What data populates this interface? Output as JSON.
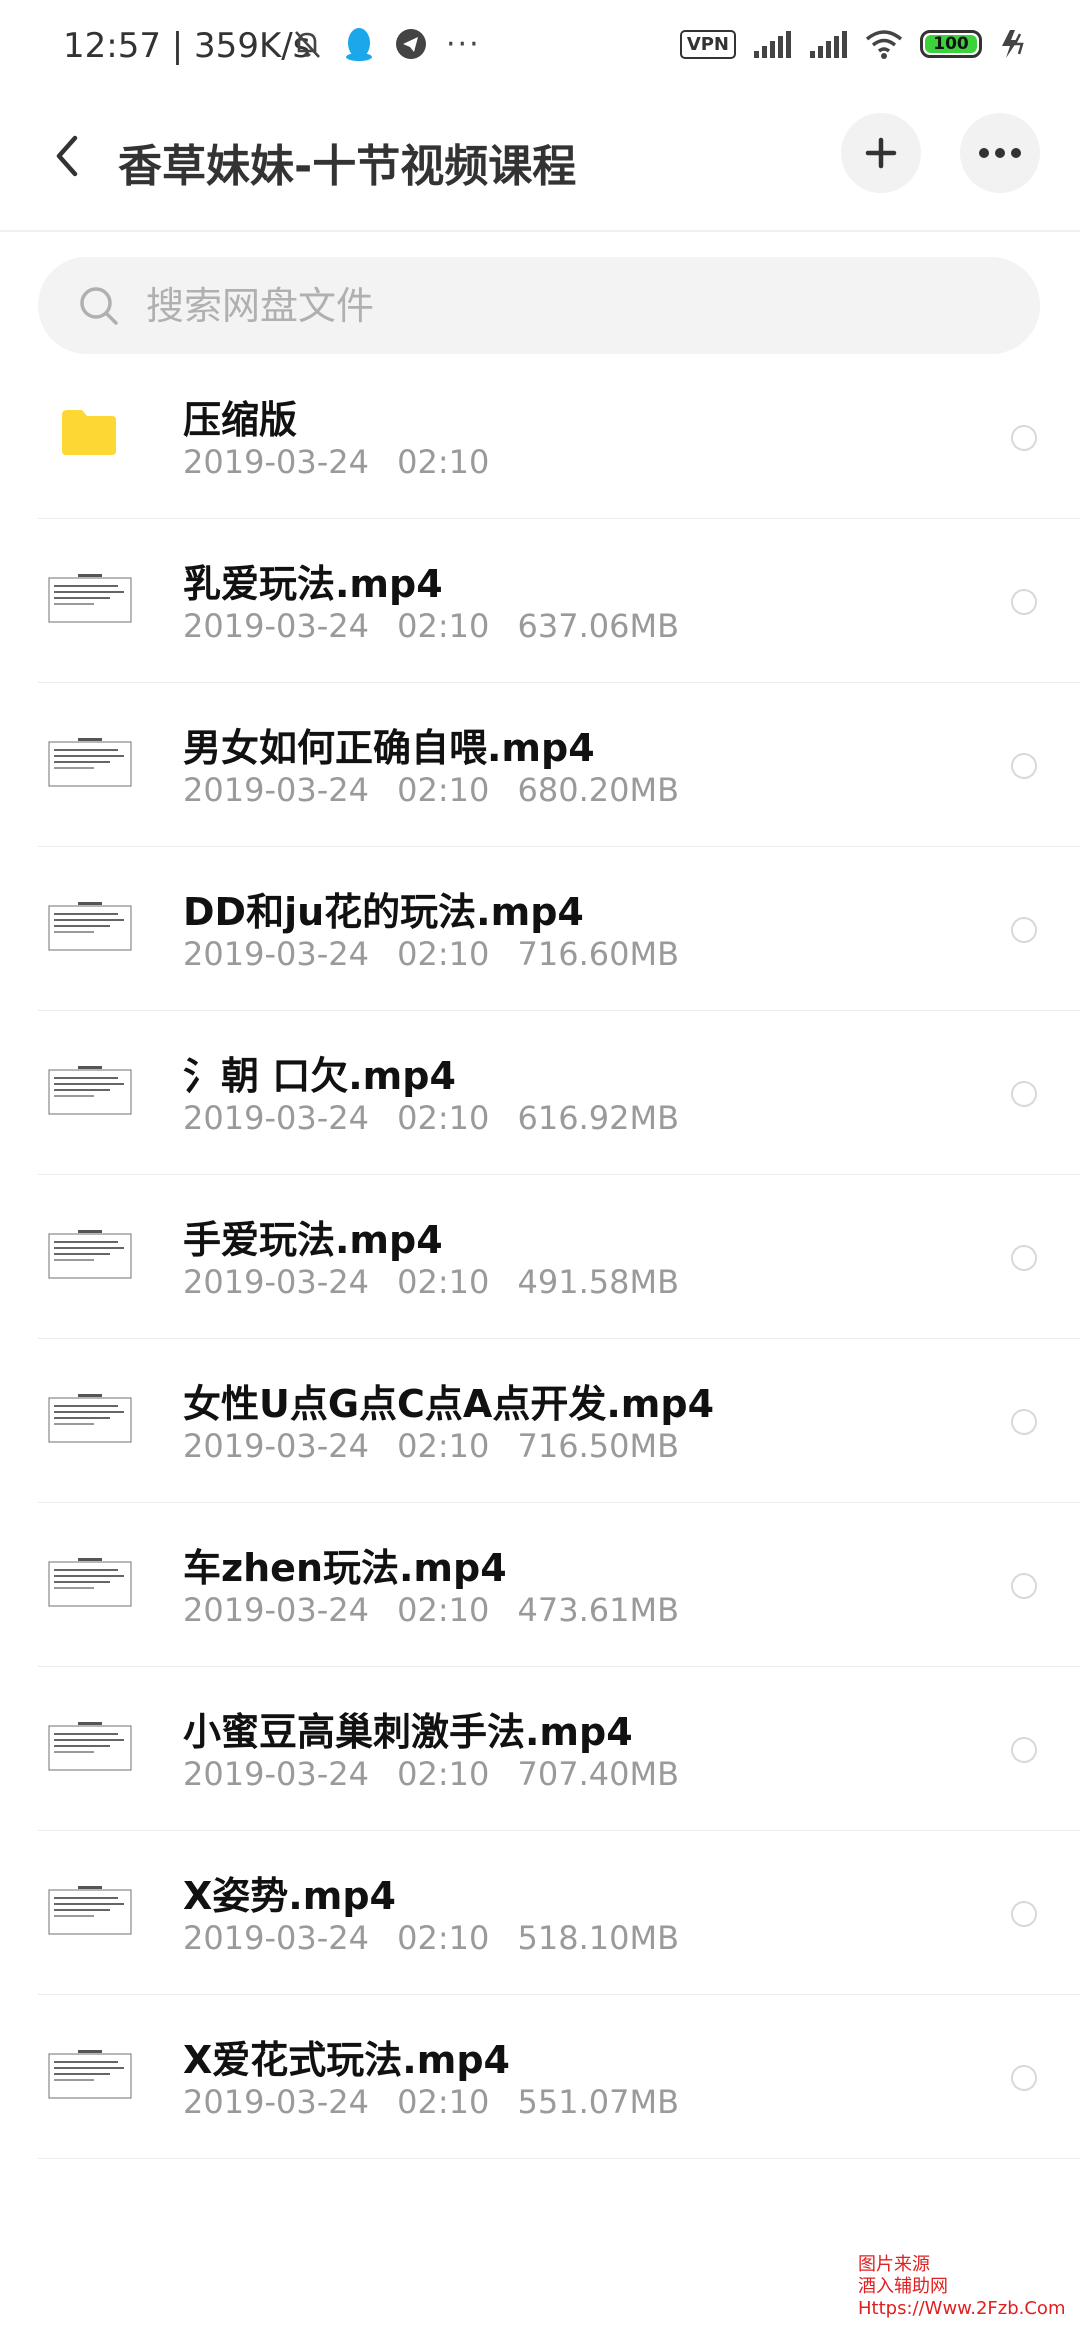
{
  "status_bar": {
    "time_speed": "12:57 | 359K/s",
    "more_dots": "···",
    "vpn": "VPN",
    "battery": "100",
    "battery_level_percent": 100,
    "colors": {
      "battery_fill": "#3cd23c"
    }
  },
  "header": {
    "title": "香草妹妹-十节视频课程",
    "back_icon": "chevron-left-icon",
    "add_icon": "plus-icon",
    "more_icon": "more-horizontal-icon"
  },
  "search": {
    "placeholder": "搜索网盘文件",
    "icon": "search-icon"
  },
  "files": [
    {
      "type": "folder",
      "name": "压缩版",
      "date": "2019-03-24",
      "time": "02:10",
      "size": ""
    },
    {
      "type": "video",
      "name": "乳爱玩法.mp4",
      "date": "2019-03-24",
      "time": "02:10",
      "size": "637.06MB"
    },
    {
      "type": "video",
      "name": "男女如何正确自喂.mp4",
      "date": "2019-03-24",
      "time": "02:10",
      "size": "680.20MB"
    },
    {
      "type": "video",
      "name": "DD和ju花的玩法.mp4",
      "date": "2019-03-24",
      "time": "02:10",
      "size": "716.60MB"
    },
    {
      "type": "video",
      "name": "氵朝 口欠.mp4",
      "date": "2019-03-24",
      "time": "02:10",
      "size": "616.92MB"
    },
    {
      "type": "video",
      "name": "手爱玩法.mp4",
      "date": "2019-03-24",
      "time": "02:10",
      "size": "491.58MB"
    },
    {
      "type": "video",
      "name": "女性U点G点C点A点开发.mp4",
      "date": "2019-03-24",
      "time": "02:10",
      "size": "716.50MB"
    },
    {
      "type": "video",
      "name": "车zhen玩法.mp4",
      "date": "2019-03-24",
      "time": "02:10",
      "size": "473.61MB"
    },
    {
      "type": "video",
      "name": "小蜜豆高巢刺激手法.mp4",
      "date": "2019-03-24",
      "time": "02:10",
      "size": "707.40MB"
    },
    {
      "type": "video",
      "name": "X姿势.mp4",
      "date": "2019-03-24",
      "time": "02:10",
      "size": "518.10MB"
    },
    {
      "type": "video",
      "name": "X爱花式玩法.mp4",
      "date": "2019-03-24",
      "time": "02:10",
      "size": "551.07MB"
    }
  ],
  "colors": {
    "folder": "#fdd835",
    "accent_text": "#111111",
    "meta_text": "#9a9a9a"
  },
  "watermark": {
    "line1": "图片来源",
    "line2": "酒入辅助网",
    "line3": "Https://Www.2Fzb.Com"
  }
}
